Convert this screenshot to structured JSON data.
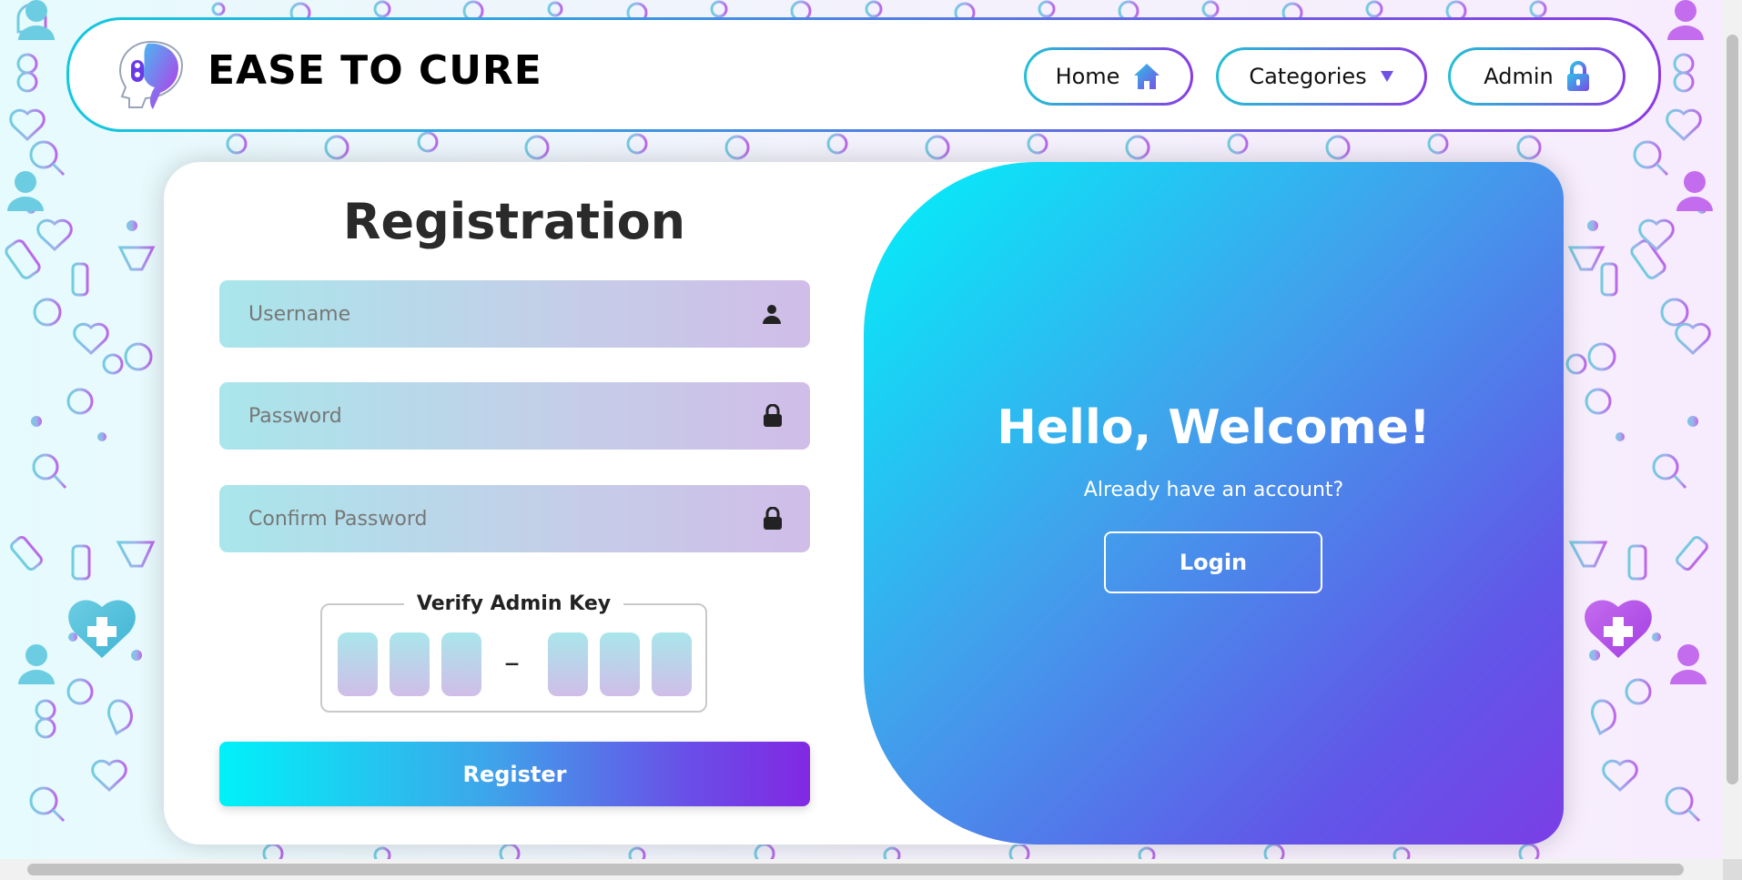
{
  "brand": {
    "name": "EASE TO CURE",
    "logo_icon": "head-profile-logo-icon"
  },
  "nav": {
    "home": {
      "label": "Home",
      "icon": "home-icon"
    },
    "categories": {
      "label": "Categories",
      "icon": "caret-down-icon"
    },
    "admin": {
      "label": "Admin",
      "icon": "lock-icon"
    }
  },
  "registration": {
    "title": "Registration",
    "username": {
      "placeholder": "Username",
      "value": "",
      "icon": "user-icon"
    },
    "password": {
      "placeholder": "Password",
      "value": "",
      "icon": "lock-icon"
    },
    "confirm_password": {
      "placeholder": "Confirm Password",
      "value": "",
      "icon": "lock-icon"
    },
    "admin_key": {
      "label": "Verify Admin Key",
      "separator": "–",
      "digits": [
        "",
        "",
        "",
        "",
        "",
        ""
      ]
    },
    "register_label": "Register"
  },
  "welcome": {
    "title": "Hello, Welcome!",
    "subtitle": "Already have an account?",
    "login_label": "Login"
  },
  "colors": {
    "accent_cyan": "#00f2fa",
    "accent_purple": "#8228e3",
    "pattern_cyan": "#5cc6dc",
    "pattern_purple": "#b24fe6"
  }
}
